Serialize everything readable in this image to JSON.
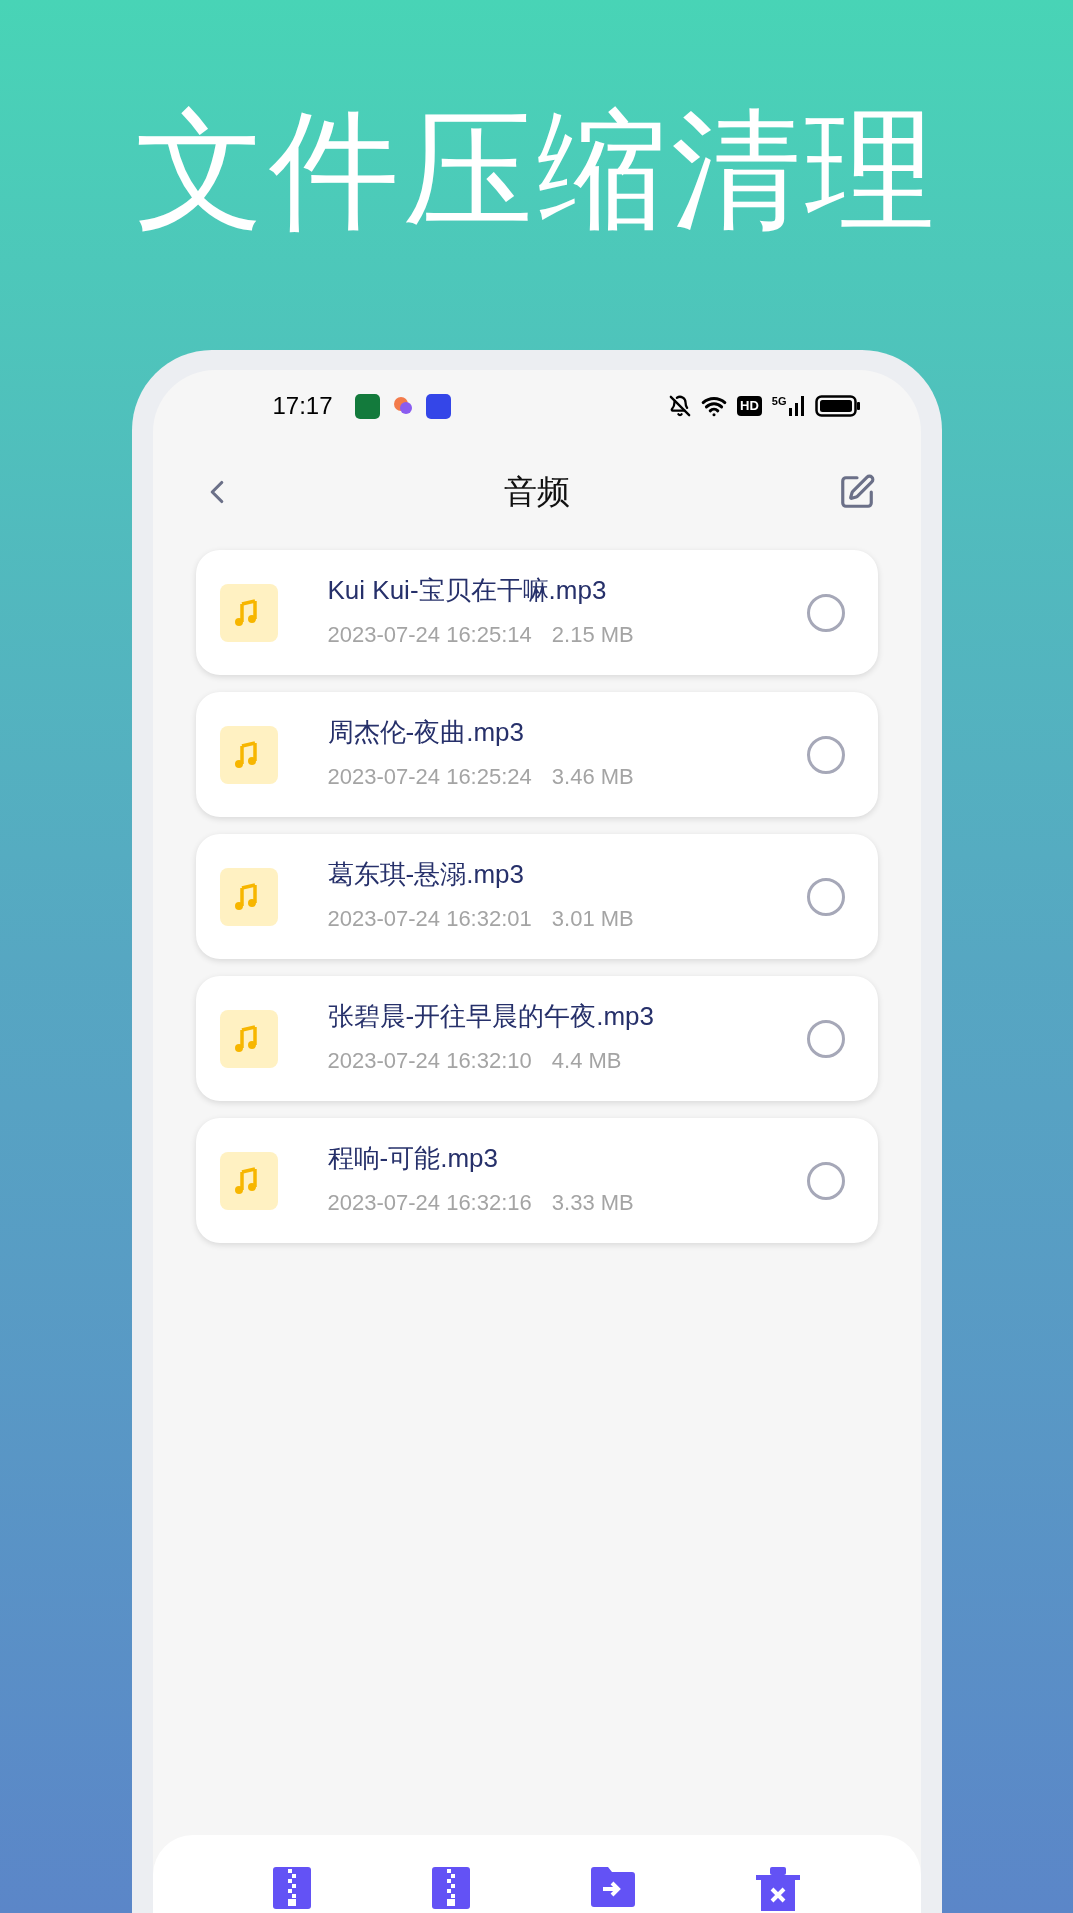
{
  "headline": "文件压缩清理",
  "status_bar": {
    "time": "17:17",
    "hd": "HD",
    "network": "5G"
  },
  "nav": {
    "title": "音频"
  },
  "files": [
    {
      "name": "Kui Kui-宝贝在干嘛.mp3",
      "date": "2023-07-24 16:25:14",
      "size": "2.15 MB",
      "selected": false
    },
    {
      "name": "周杰伦-夜曲.mp3",
      "date": "2023-07-24 16:25:24",
      "size": "3.46 MB",
      "selected": false
    },
    {
      "name": "葛东琪-悬溺.mp3",
      "date": "2023-07-24 16:32:01",
      "size": "3.01 MB",
      "selected": false
    },
    {
      "name": "张碧晨-开往早晨的午夜.mp3",
      "date": "2023-07-24 16:32:10",
      "size": "4.4 MB",
      "selected": false
    },
    {
      "name": "程响-可能.mp3",
      "date": "2023-07-24 16:32:16",
      "size": "3.33 MB",
      "selected": false
    }
  ],
  "toolbar": [
    {
      "kind": "zip"
    },
    {
      "kind": "zip"
    },
    {
      "kind": "move"
    },
    {
      "kind": "delete"
    }
  ]
}
